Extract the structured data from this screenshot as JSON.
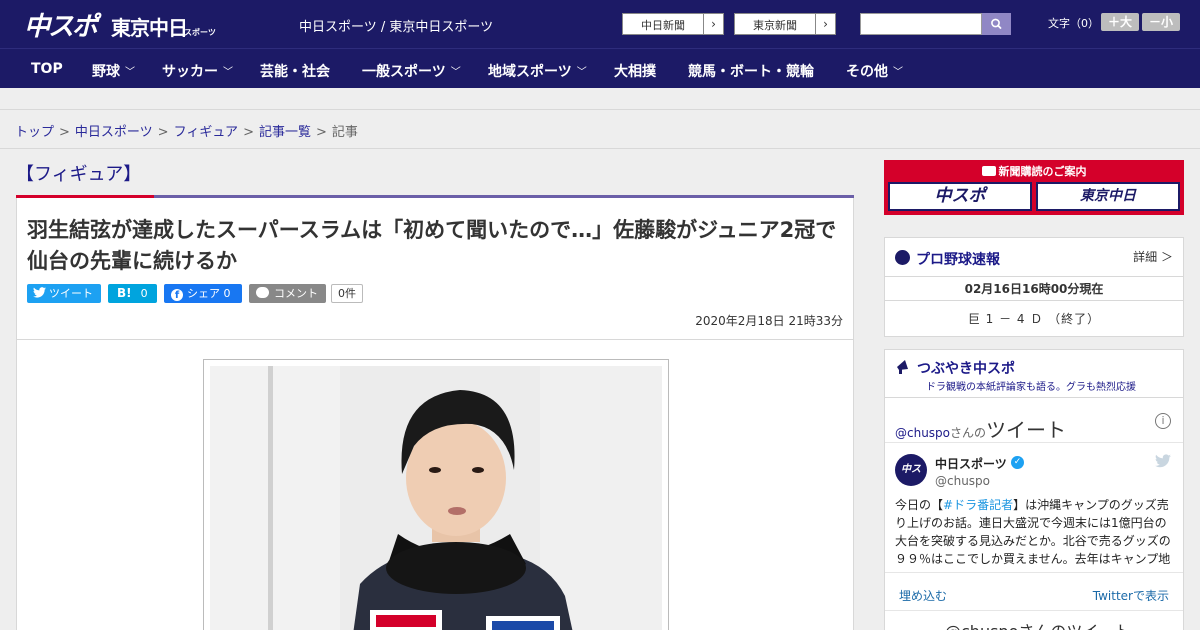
{
  "header": {
    "logo_main": "中スポ",
    "logo_tokyo": "東京中日",
    "logo_tokyo_sub": "スポーツ",
    "site_name": "中日スポーツ / 東京中日スポーツ",
    "ext_links": [
      "中日新聞",
      "東京新聞"
    ],
    "font_size_label": "文字（0）",
    "font_up": "＋大",
    "font_down": "－小",
    "search_placeholder": ""
  },
  "nav": [
    {
      "label": "TOP",
      "dropdown": false
    },
    {
      "label": "野球",
      "dropdown": true
    },
    {
      "label": "サッカー",
      "dropdown": true
    },
    {
      "label": "芸能・社会",
      "dropdown": false
    },
    {
      "label": "一般スポーツ",
      "dropdown": true
    },
    {
      "label": "地域スポーツ",
      "dropdown": true
    },
    {
      "label": "大相撲",
      "dropdown": false
    },
    {
      "label": "競馬・ボート・競輪",
      "dropdown": false
    },
    {
      "label": "その他",
      "dropdown": true
    }
  ],
  "breadcrumb": {
    "links": [
      "トップ",
      "中日スポーツ",
      "フィギュア",
      "記事一覧"
    ],
    "current": "記事"
  },
  "article": {
    "category": "【フィギュア】",
    "headline": "羽生結弦が達成したスーパースラムは「初めて聞いたので…」佐藤駿がジュニア2冠で仙台の先輩に続けるか",
    "share": {
      "tweet": "ツイート",
      "hatena_count": "0",
      "facebook": "シェア 0",
      "comment": "コメント",
      "comment_count": "0件"
    },
    "date": "2020年2月18日 21時33分"
  },
  "sidebar": {
    "subscribe_title": "新聞購読のご案内",
    "subscribe_buttons": [
      "中スポ",
      "東京中日"
    ],
    "baseball": {
      "title": "プロ野球速報",
      "detail": "詳細 ＞",
      "time": "02月16日16時00分現在",
      "score": "巨 1 － 4 Ｄ （終了）"
    },
    "tweets": {
      "title": "つぶやき中スポ",
      "subtitle": "ドラ観戦の本紙評論家も語る。グラも熱烈応援",
      "handle": "@chuspo",
      "handle_suffix": "さんの",
      "tweet_word": "ツイート",
      "account_name": "中日スポーツ",
      "account_user": "@chuspo",
      "text_before": "今日の【",
      "text_tag": "#ドラ番記者",
      "text_after": "】は沖縄キャンプのグッズ売り上げのお話。連日大盛況で今週末には1億円台の大台を突破する見込みだとか。北谷で売るグッズの９９％はここでしか買えません。去年はキャンプ地",
      "embed": "埋め込む",
      "view": "Twitterで表示",
      "footer": "@chuspoさんのツイート"
    }
  }
}
